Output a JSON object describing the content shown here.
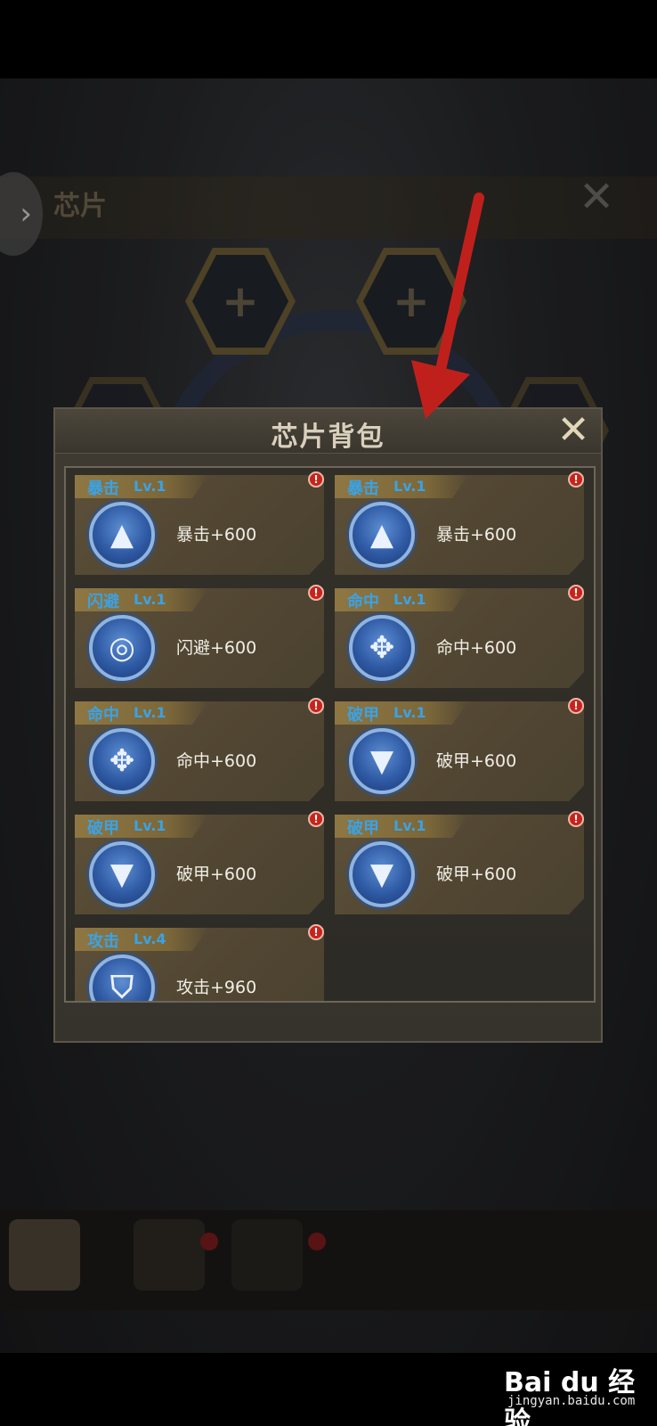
{
  "background": {
    "title": "芯片",
    "close_glyph": "✕",
    "side_arrow_glyph": "›",
    "hex_plus": "+"
  },
  "dialog": {
    "title": "芯片背包",
    "close_glyph": "✕"
  },
  "chips": [
    {
      "name": "暴击",
      "level": "Lv.1",
      "effect": "暴击+600",
      "icon": "crit-chip-icon",
      "glyph": "▲"
    },
    {
      "name": "暴击",
      "level": "Lv.1",
      "effect": "暴击+600",
      "icon": "crit-chip-icon",
      "glyph": "▲"
    },
    {
      "name": "闪避",
      "level": "Lv.1",
      "effect": "闪避+600",
      "icon": "dodge-chip-icon",
      "glyph": "◎"
    },
    {
      "name": "命中",
      "level": "Lv.1",
      "effect": "命中+600",
      "icon": "hit-chip-icon",
      "glyph": "✥"
    },
    {
      "name": "命中",
      "level": "Lv.1",
      "effect": "命中+600",
      "icon": "hit-chip-icon",
      "glyph": "✥"
    },
    {
      "name": "破甲",
      "level": "Lv.1",
      "effect": "破甲+600",
      "icon": "armor-break-chip-icon",
      "glyph": "▼"
    },
    {
      "name": "破甲",
      "level": "Lv.1",
      "effect": "破甲+600",
      "icon": "armor-break-chip-icon",
      "glyph": "▼"
    },
    {
      "name": "破甲",
      "level": "Lv.1",
      "effect": "破甲+600",
      "icon": "armor-break-chip-icon",
      "glyph": "▼"
    },
    {
      "name": "攻击",
      "level": "Lv.4",
      "effect": "攻击+960",
      "icon": "attack-chip-icon",
      "glyph": "⛉"
    }
  ],
  "alert_glyph": "!",
  "colors": {
    "tag_text": "#3aa2e6",
    "alert": "#c8221c",
    "annotation_arrow": "#c0201c"
  },
  "watermark": {
    "brand": "Bai du 经验",
    "url": "jingyan.baidu.com"
  }
}
